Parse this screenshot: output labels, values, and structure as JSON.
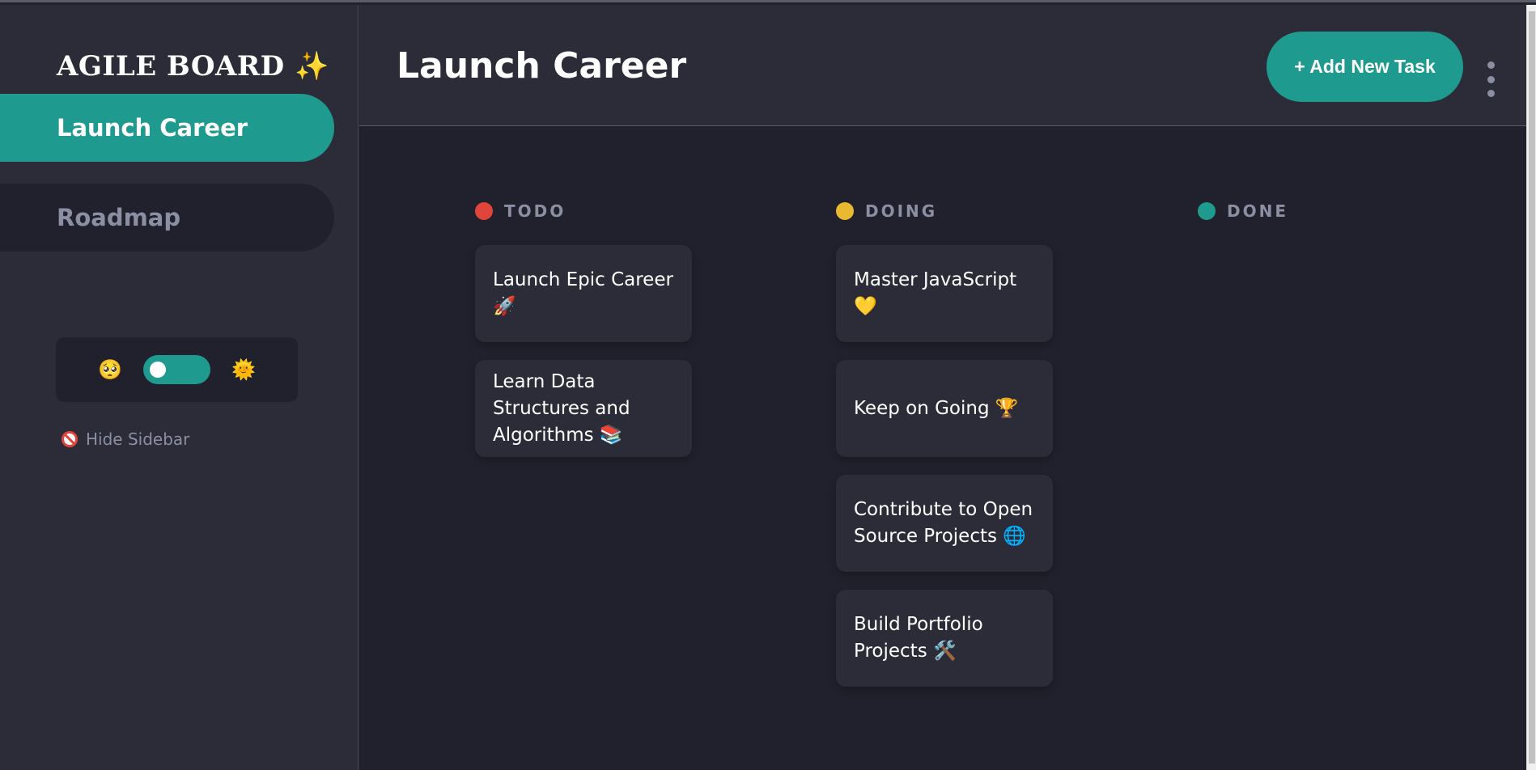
{
  "sidebar": {
    "logo_text": "AGILE BOARD",
    "logo_sparkle": "✨",
    "boards": [
      {
        "label": "Launch Career",
        "active": true
      },
      {
        "label": "Roadmap",
        "active": false
      }
    ],
    "theme": {
      "dark_icon": "🥺",
      "light_icon": "🌞",
      "icon_names": [
        "moon-face-icon",
        "sun-face-icon"
      ]
    },
    "hide_label": "Hide Sidebar"
  },
  "header": {
    "title": "Launch Career",
    "add_button": "+ Add New Task"
  },
  "columns": [
    {
      "name": "TODO",
      "color": "#e0443a",
      "cards": [
        "Launch Epic Career 🚀",
        "Learn Data Structures and Algorithms 📚"
      ]
    },
    {
      "name": "DOING",
      "color": "#eab92f",
      "cards": [
        "Master JavaScript 💛",
        "Keep on Going 🏆",
        "Contribute to Open Source Projects 🌐",
        "Build Portfolio Projects 🛠️"
      ]
    },
    {
      "name": "DONE",
      "color": "#1f9a8e",
      "cards": []
    }
  ],
  "colors": {
    "accent": "#1f9a8e",
    "background": "#20212c",
    "panel": "#2b2c37"
  }
}
